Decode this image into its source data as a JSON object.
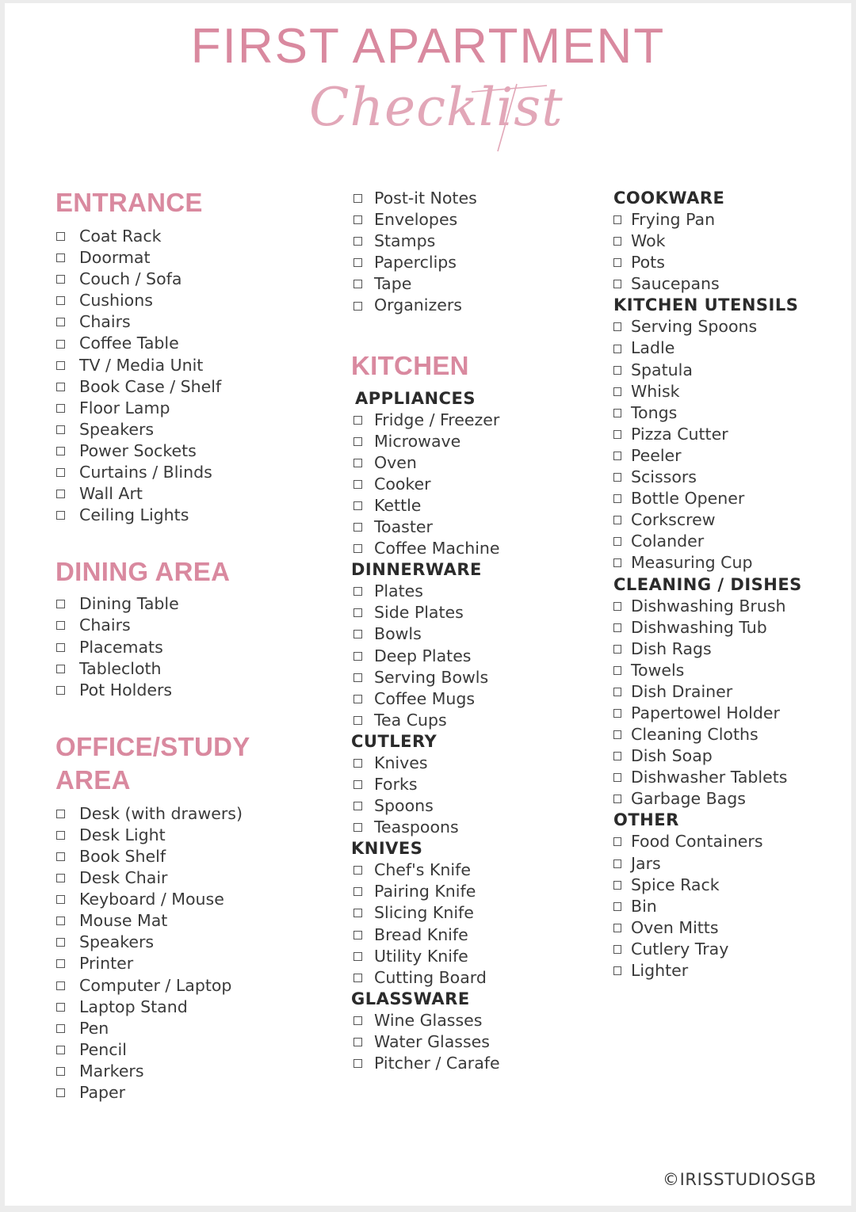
{
  "header": {
    "title": "FIRST APARTMENT",
    "subtitle": "Checklist"
  },
  "colors": {
    "accent_pink": "#d9899f",
    "script_pink": "#e2a7b8",
    "text_dark": "#3a3a3a"
  },
  "entrance": {
    "title": "ENTRANCE",
    "items": [
      "Coat Rack",
      "Doormat",
      "Couch / Sofa",
      "Cushions",
      "Chairs",
      "Coffee Table",
      "TV / Media Unit",
      "Book Case / Shelf",
      "Floor Lamp",
      "Speakers",
      "Power Sockets",
      "Curtains / Blinds",
      "Wall Art",
      "Ceiling Lights"
    ]
  },
  "dining": {
    "title": "DINING AREA",
    "items": [
      "Dining Table",
      "Chairs",
      "Placemats",
      "Tablecloth",
      "Pot Holders"
    ]
  },
  "office": {
    "title_line1": "OFFICE/STUDY",
    "title_line2": "AREA",
    "items": [
      "Desk (with drawers)",
      "Desk Light",
      "Book Shelf",
      "Desk Chair",
      "Keyboard / Mouse",
      "Mouse Mat",
      "Speakers",
      "Printer",
      "Computer / Laptop",
      "Laptop Stand",
      "Pen",
      "Pencil",
      "Markers",
      "Paper"
    ],
    "items_continued": [
      "Post-it Notes",
      "Envelopes",
      "Stamps",
      "Paperclips",
      "Tape",
      "Organizers"
    ]
  },
  "kitchen": {
    "title": "KITCHEN",
    "appliances": {
      "title": "APPLIANCES",
      "items": [
        "Fridge / Freezer",
        "Microwave",
        "Oven",
        "Cooker",
        "Kettle",
        "Toaster",
        "Coffee Machine"
      ]
    },
    "dinnerware": {
      "title": "DINNERWARE",
      "items": [
        "Plates",
        "Side Plates",
        "Bowls",
        "Deep Plates",
        "Serving Bowls",
        "Coffee Mugs",
        "Tea Cups"
      ]
    },
    "cutlery": {
      "title": "CUTLERY",
      "items": [
        "Knives",
        "Forks",
        "Spoons",
        "Teaspoons"
      ]
    },
    "knives": {
      "title": "KNIVES",
      "items": [
        "Chef's Knife",
        "Pairing Knife",
        "Slicing Knife",
        "Bread Knife",
        "Utility Knife",
        "Cutting Board"
      ]
    },
    "glassware": {
      "title": "GLASSWARE",
      "items": [
        "Wine Glasses",
        "Water Glasses",
        "Pitcher / Carafe"
      ]
    },
    "cookware": {
      "title": "COOKWARE",
      "items": [
        "Frying Pan",
        "Wok",
        "Pots",
        "Saucepans"
      ]
    },
    "utensils": {
      "title": "KITCHEN UTENSILS",
      "items": [
        "Serving Spoons",
        "Ladle",
        "Spatula",
        "Whisk",
        "Tongs",
        "Pizza Cutter",
        "Peeler",
        "Scissors",
        "Bottle Opener",
        "Corkscrew",
        "Colander",
        "Measuring Cup"
      ]
    },
    "cleaning": {
      "title": "CLEANING / DISHES",
      "items": [
        "Dishwashing Brush",
        "Dishwashing Tub",
        "Dish Rags",
        "Towels",
        "Dish Drainer",
        "Papertowel Holder",
        "Cleaning Cloths",
        "Dish Soap",
        "Dishwasher Tablets",
        "Garbage Bags"
      ]
    },
    "other": {
      "title": "OTHER",
      "items": [
        "Food Containers",
        "Jars",
        "Spice Rack",
        "Bin",
        "Oven Mitts",
        "Cutlery Tray",
        "Lighter"
      ]
    }
  },
  "footer": {
    "copyright": "©IRISSTUDIOSGB"
  }
}
